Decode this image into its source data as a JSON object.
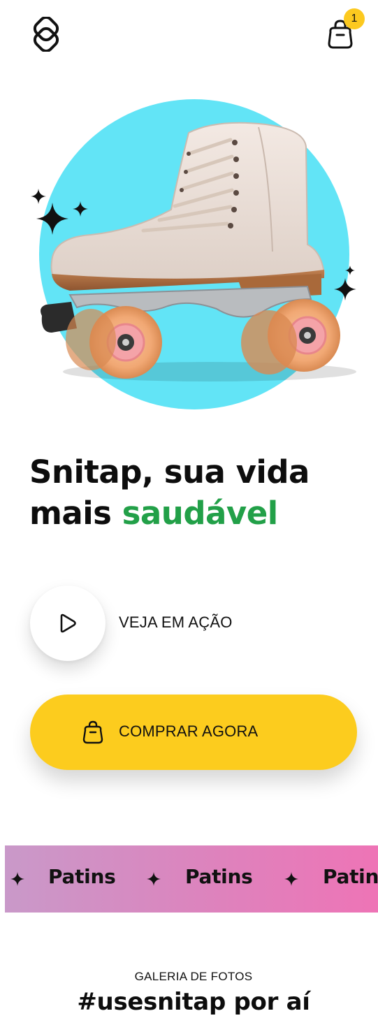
{
  "header": {
    "logo_icon": "snitap-logo-icon",
    "cart_icon": "shopping-bag-icon",
    "cart_count": "1"
  },
  "hero": {
    "image": "roller-skate-image",
    "circle_color": "#62e4f6",
    "headline_line1": "Snitap, sua vida",
    "headline_line2_prefix": "mais ",
    "headline_accent": "saudável",
    "accent_color": "#22a048"
  },
  "actions": {
    "play_icon": "play-icon",
    "play_label": "VEJA EM AÇÃO",
    "buy_icon": "shopping-bag-icon",
    "buy_label": "COMPRAR AGORA",
    "buy_color": "#fccc1e"
  },
  "marquee": {
    "items": [
      "Patins",
      "Patins",
      "Patins"
    ],
    "separator_icon": "sparkle-star-icon"
  },
  "gallery": {
    "kicker": "GALERIA DE FOTOS",
    "title": "#usesnitap por aí"
  }
}
